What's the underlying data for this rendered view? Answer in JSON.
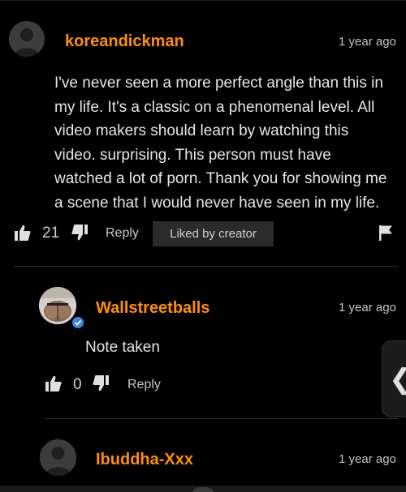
{
  "colors": {
    "background": "#000000",
    "username": "#ff9000",
    "verified": "#3a86e8"
  },
  "comments": [
    {
      "username": "koreandickman",
      "time": "1 year ago",
      "avatar_icon": "default-avatar-icon",
      "body_lines": [
        "I've never seen a more perfect angle than this in",
        "my life. It's a classic on a phenomenal level. All",
        "video makers should learn by watching this",
        "video. surprising. This person must have",
        "watched a lot of porn. Thank you for showing me",
        "a scene that I would never have seen in my life."
      ],
      "votes": "21",
      "reply_label": "Reply",
      "badge": "Liked by creator",
      "flag_icon": "flag-icon"
    },
    {
      "username": "Wallstreetballs",
      "time": "1 year ago",
      "avatar_icon": "user-photo-avatar",
      "verified_icon": "verified-check-icon",
      "body": "Note taken",
      "votes": "0",
      "reply_label": "Reply"
    },
    {
      "username": "Ibuddha-Xxx",
      "time": "1 year ago",
      "avatar_icon": "default-avatar-icon"
    }
  ],
  "side_handle": {
    "glyph": "❮",
    "icon": "chevron-left-icon"
  }
}
